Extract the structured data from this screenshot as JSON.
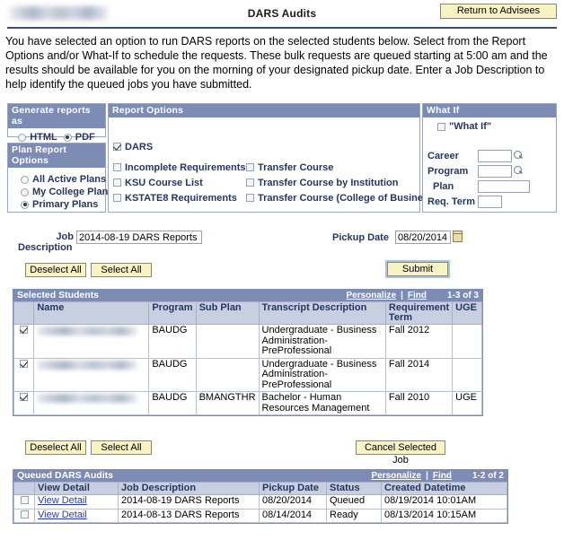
{
  "header": {
    "advisee_name_redacted": "",
    "title": "DARS Audits",
    "return_button": "Return to Advisees"
  },
  "intro": {
    "text": "You have selected an option to run DARS reports on the selected students below. Select from the Report Options and/or What-If to schedule the requests. These bulk requests are queued starting at 5:00 am and the results should be available for you on the morning of your designated pickup date. Enter a Job Description to help identify the queued jobs you have submitted."
  },
  "generate_panel": {
    "title": "Generate reports as",
    "options": [
      {
        "label": "HTML",
        "selected": false
      },
      {
        "label": "PDF",
        "selected": true
      }
    ]
  },
  "plan_panel": {
    "title": "Plan Report Options",
    "options": [
      {
        "label": "All Active Plans",
        "selected": false
      },
      {
        "label": "My College Plans",
        "selected": false
      },
      {
        "label": "Primary Plans",
        "selected": true
      }
    ]
  },
  "report_panel": {
    "title": "Report Options",
    "options": [
      {
        "label": "DARS",
        "checked": true
      },
      {
        "label": "Incomplete Requirements",
        "checked": false
      },
      {
        "label": "KSU Course List",
        "checked": false
      },
      {
        "label": "KSTATE8 Requirements",
        "checked": false
      },
      {
        "label": "Transfer Course",
        "checked": false
      },
      {
        "label": "Transfer Course by Institution",
        "checked": false
      },
      {
        "label": "Transfer Course (College of Business)",
        "checked": false
      }
    ]
  },
  "whatif_panel": {
    "title": "What If",
    "checkbox_label": "\"What If\"",
    "checkbox_checked": false,
    "fields": [
      {
        "label": "Career",
        "value": "",
        "lookup": true
      },
      {
        "label": "Program",
        "value": "",
        "lookup": true
      },
      {
        "label": "Plan",
        "value": "",
        "lookup": false
      },
      {
        "label": "Req. Term",
        "value": "",
        "lookup": false
      }
    ]
  },
  "job": {
    "label_line1": "Job",
    "label_line2": "Description",
    "description_value": "2014-08-19 DARS Reports",
    "pickup_date_label": "Pickup Date",
    "pickup_date_value": "08/20/2014",
    "calendar_icon": "calendar-icon"
  },
  "buttons": {
    "deselect_all_top": "Deselect All",
    "select_all_top": "Select All",
    "submit": "Submit",
    "deselect_all_bottom": "Deselect All",
    "select_all_bottom": "Select All",
    "cancel_selected_job": "Cancel Selected Job"
  },
  "students_grid": {
    "title": "Selected Students",
    "personalize_link": "Personalize",
    "separator": "|",
    "find_link": "Find",
    "row_count": "1-3 of 3",
    "columns": [
      "",
      "Name",
      "Program",
      "Sub Plan",
      "Transcript Description",
      "Requirement Term",
      "UGE"
    ],
    "rows": [
      {
        "selected": true,
        "name": "",
        "program": "BAUDG",
        "sub_plan": "",
        "transcript_description": "Undergraduate - Business Administration-PreProfessional",
        "requirement_term": "Fall 2012",
        "uge": ""
      },
      {
        "selected": true,
        "name": "",
        "program": "BAUDG",
        "sub_plan": "",
        "transcript_description": "Undergraduate - Business Administration-PreProfessional",
        "requirement_term": "Fall 2014",
        "uge": ""
      },
      {
        "selected": true,
        "name": "",
        "program": "BAUDG",
        "sub_plan": "BMANGTHR",
        "transcript_description": "Bachelor - Human Resources Management",
        "requirement_term": "Fall 2010",
        "uge": "UGE"
      }
    ]
  },
  "queued_grid": {
    "title": "Queued DARS Audits",
    "personalize_link": "Personalize",
    "separator": "|",
    "find_link": "Find",
    "row_count": "1-2 of 2",
    "columns": [
      "",
      "View Detail",
      "Job Description",
      "Pickup Date",
      "Status",
      "Created Datetime"
    ],
    "rows": [
      {
        "selected": false,
        "view_detail": "View Detail",
        "job_description": "2014-08-19 DARS Reports",
        "pickup_date": "08/20/2014",
        "status": "Queued",
        "created_datetime": "08/19/2014 10:01AM"
      },
      {
        "selected": false,
        "view_detail": "View Detail",
        "job_description": "2014-08-13 DARS Reports",
        "pickup_date": "08/14/2014",
        "status": "Ready",
        "created_datetime": "08/13/2014 10:15AM"
      }
    ]
  },
  "colors": {
    "panel_header": "#7c8cb4",
    "column_header": "#c7cfe1",
    "button_face": "#f7f3c6",
    "label_text": "#26365e",
    "link": "#2b3fa0"
  }
}
